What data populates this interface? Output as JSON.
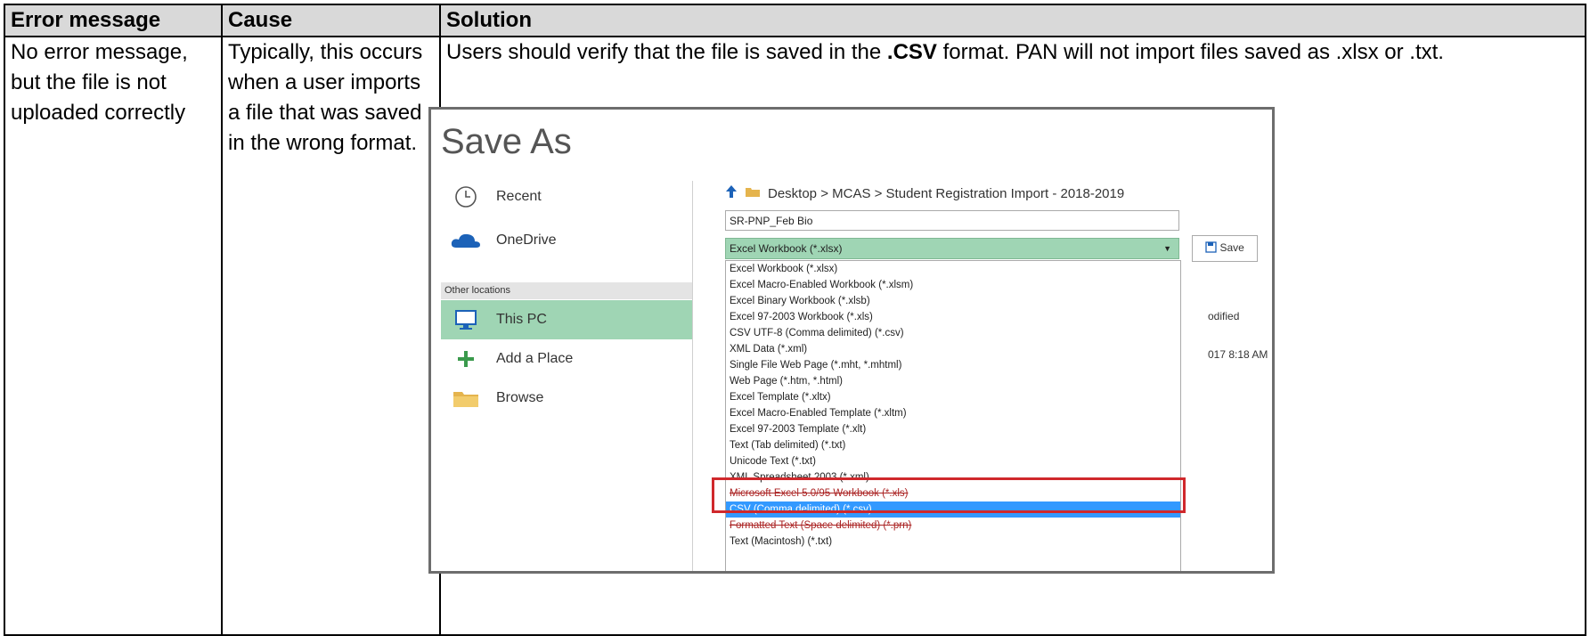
{
  "table": {
    "headers": [
      "Error message",
      "Cause",
      "Solution"
    ],
    "error_message": "No error message, but the file is not uploaded correctly",
    "cause": "Typically, this occurs when a user imports a file that was saved in the wrong format.",
    "solution": {
      "before": "Users should verify that the file is saved in the ",
      "bold": ".CSV",
      "after": " format. PAN will not import files saved as .xlsx or .txt."
    }
  },
  "save_as": {
    "title": "Save As",
    "nav": {
      "recent": "Recent",
      "onedrive": "OneDrive",
      "other_locations": "Other locations",
      "this_pc": "This PC",
      "add_place": "Add a Place",
      "browse": "Browse"
    },
    "path": "Desktop > MCAS > Student Registration Import - 2018-2019",
    "file_name": "SR-PNP_Feb Bio",
    "file_type": "Excel Workbook (*.xlsx)",
    "save_label": "Save",
    "right_fragments": [
      "odified",
      "017 8:18 AM"
    ],
    "options": [
      "Excel Workbook (*.xlsx)",
      "Excel Macro-Enabled Workbook (*.xlsm)",
      "Excel Binary Workbook (*.xlsb)",
      "Excel 97-2003 Workbook (*.xls)",
      "CSV UTF-8 (Comma delimited) (*.csv)",
      "XML Data (*.xml)",
      "Single File Web Page (*.mht, *.mhtml)",
      "Web Page (*.htm, *.html)",
      "Excel Template (*.xltx)",
      "Excel Macro-Enabled Template (*.xltm)",
      "Excel 97-2003 Template (*.xlt)",
      "Text (Tab delimited) (*.txt)",
      "Unicode Text (*.txt)",
      "XML Spreadsheet 2003 (*.xml)",
      "Microsoft Excel 5.0/95 Workbook (*.xls)",
      "CSV (Comma delimited) (*.csv)",
      "Formatted Text (Space delimited) (*.prn)",
      "Text (Macintosh) (*.txt)"
    ],
    "highlighted_option": "CSV (Comma delimited) (*.csv)",
    "colors": {
      "selected_green": "#9fd5b4",
      "highlight_blue": "#3399ff",
      "callout_red": "#d0282c"
    }
  }
}
